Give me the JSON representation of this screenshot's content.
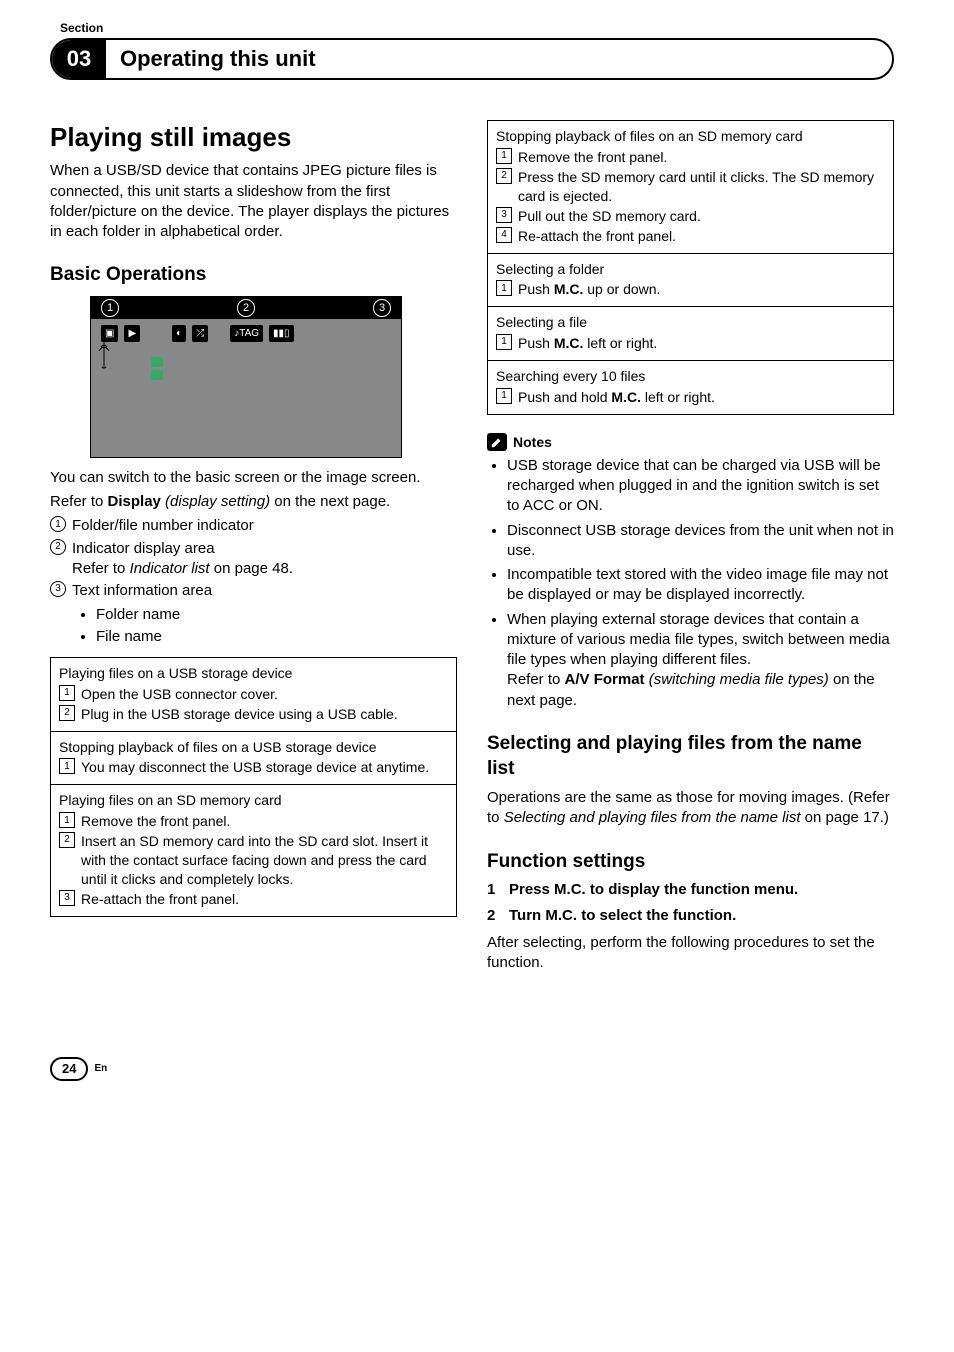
{
  "section_label": "Section",
  "section_number": "03",
  "header_title": "Operating this unit",
  "left": {
    "h1": "Playing still images",
    "intro": "When a USB/SD device that contains JPEG picture files is connected, this unit starts a slideshow from the first folder/picture on the device. The player displays the pictures in each folder in alphabetical order.",
    "h2_basic": "Basic Operations",
    "illus_nums": [
      "1",
      "2",
      "3"
    ],
    "switch_text": "You can switch to the basic screen or the image screen.",
    "refer_prefix": "Refer to ",
    "refer_bold": "Display",
    "refer_italic": " (display setting)",
    "refer_suffix": " on the next page.",
    "items": [
      {
        "n": "1",
        "text": "Folder/file number indicator"
      },
      {
        "n": "2",
        "text": "Indicator display area",
        "sub_prefix": "Refer to ",
        "sub_italic": "Indicator list",
        "sub_suffix": " on page 48."
      },
      {
        "n": "3",
        "text": "Text information area",
        "bullets": [
          "Folder name",
          "File name"
        ]
      }
    ],
    "table": [
      {
        "title": "Playing files on a USB storage device",
        "steps": [
          "Open the USB connector cover.",
          "Plug in the USB storage device using a USB cable."
        ]
      },
      {
        "title": "Stopping playback of files on a USB storage device",
        "steps": [
          "You may disconnect the USB storage device at anytime."
        ]
      },
      {
        "title": "Playing files on an SD memory card",
        "steps": [
          "Remove the front panel.",
          "Insert an SD memory card into the SD card slot. Insert it with the contact surface facing down and press the card until it clicks and completely locks.",
          "Re-attach the front panel."
        ]
      }
    ]
  },
  "right": {
    "table": [
      {
        "title": "Stopping playback of files on an SD memory card",
        "steps": [
          "Remove the front panel.",
          "Press the SD memory card until it clicks. The SD memory card is ejected.",
          "Pull out the SD memory card.",
          "Re-attach the front panel."
        ]
      },
      {
        "title": "Selecting a folder",
        "steps_rich": [
          {
            "pre": "Push ",
            "bold": "M.C.",
            "post": " up or down."
          }
        ]
      },
      {
        "title": "Selecting a file",
        "steps_rich": [
          {
            "pre": "Push ",
            "bold": "M.C.",
            "post": " left or right."
          }
        ]
      },
      {
        "title": "Searching every 10 files",
        "steps_rich": [
          {
            "pre": "Push and hold ",
            "bold": "M.C.",
            "post": " left or right."
          }
        ]
      }
    ],
    "notes_label": "Notes",
    "notes": [
      "USB storage device that can be charged via USB will be recharged when plugged in and the ignition switch is set to ACC or ON.",
      "Disconnect USB storage devices from the unit when not in use.",
      "Incompatible text stored with the video image file may not be displayed or may be displayed incorrectly."
    ],
    "note4_l1": "When playing external storage devices that contain a mixture of various media file types, switch between media file types when playing different files.",
    "note4_ref_prefix": "Refer to ",
    "note4_ref_bold": "A/V Format",
    "note4_ref_italic": " (switching media file types)",
    "note4_ref_suffix": " on the next page.",
    "h2_select": "Selecting and playing files from the name list",
    "select_text_pre": "Operations are the same as those for moving images. (Refer to ",
    "select_text_italic": "Selecting and playing files from the name list",
    "select_text_post": " on page 17.)",
    "h2_func": "Function settings",
    "fs_step1_n": "1",
    "fs_step1_t_pre": "Press ",
    "fs_step1_t_bold": "M.C.",
    "fs_step1_t_post": " to display the function menu.",
    "fs_step2_n": "2",
    "fs_step2_t_pre": "Turn ",
    "fs_step2_t_bold": "M.C.",
    "fs_step2_t_post": " to select the function.",
    "fs_tail": "After selecting, perform the following procedures to set the function."
  },
  "footer": {
    "page": "24",
    "lang": "En"
  }
}
